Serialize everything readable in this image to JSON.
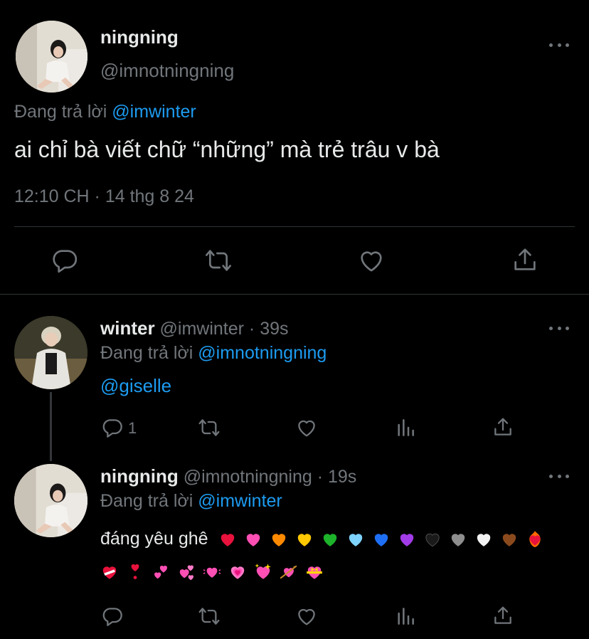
{
  "main_tweet": {
    "display_name": "ningning",
    "handle": "@imnotningning",
    "reply_prefix": "Đang trả lời",
    "reply_to": "@imwinter",
    "text": "ai chỉ bà viết chữ “những” mà trẻ trâu v bà",
    "timestamp": "12:10 CH · 14 thg 8 24"
  },
  "reply1": {
    "display_name": "winter",
    "handle_meta": "@imwinter · 39s",
    "reply_prefix": "Đang trả lời",
    "reply_to": "@imnotningning",
    "text": "@giselle",
    "reply_count": "1"
  },
  "reply2": {
    "display_name": "ningning",
    "handle_meta": "@imnotningning · 19s",
    "reply_prefix": "Đang trả lời",
    "reply_to": "@imwinter",
    "text": "đáng yêu ghê",
    "emoji_line1": [
      "red-heart",
      "pink-heart",
      "orange-heart",
      "yellow-heart",
      "green-heart",
      "light-blue-heart",
      "blue-heart",
      "purple-heart",
      "black-heart",
      "grey-heart",
      "white-heart",
      "brown-heart",
      "heart-on-fire"
    ],
    "emoji_line2": [
      "mending-heart",
      "heart-exclamation",
      "two-hearts",
      "revolving-hearts",
      "beating-heart",
      "growing-heart",
      "sparkling-heart",
      "heart-with-arrow",
      "heart-with-ribbon"
    ]
  },
  "colors": {
    "background": "#000000",
    "text": "#e7e9ea",
    "muted": "#71767b",
    "link": "#1d9bf0",
    "divider": "#2f3336"
  }
}
